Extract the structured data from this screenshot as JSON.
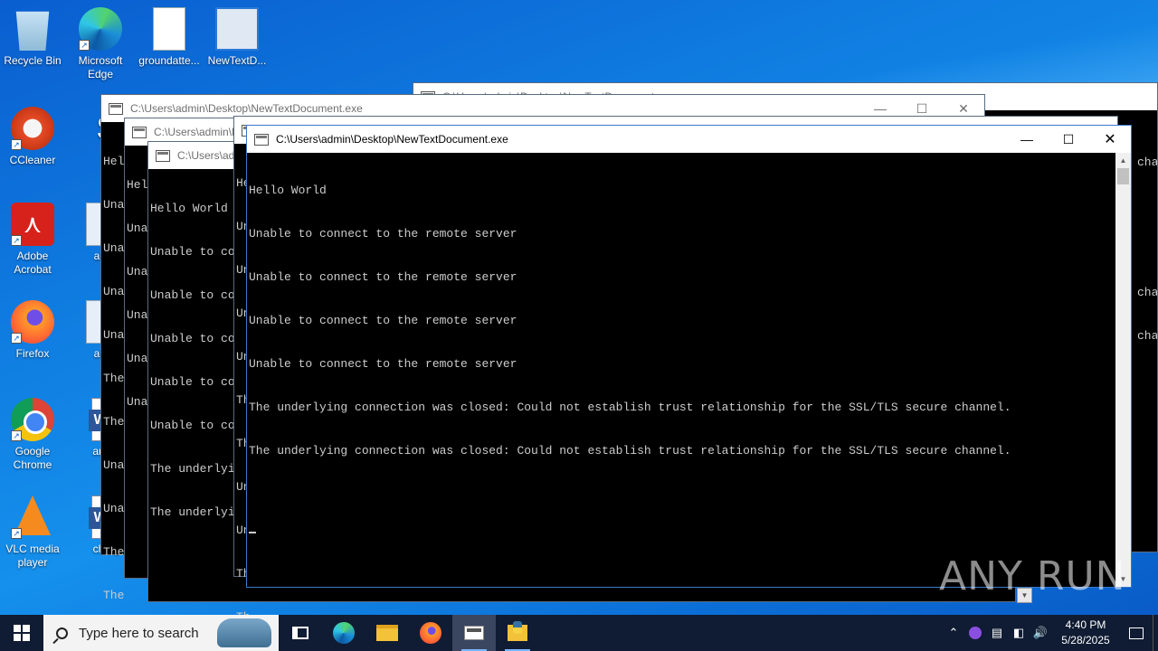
{
  "desktop": {
    "icons": [
      {
        "label": "Recycle Bin",
        "icon": "recycle-bin-icon"
      },
      {
        "label": "Microsoft Edge",
        "icon": "edge-icon"
      },
      {
        "label": "groundatte...",
        "icon": "image-file-icon"
      },
      {
        "label": "NewTextD...",
        "icon": "exe-file-icon"
      },
      {
        "label": "CCleaner",
        "icon": "ccleaner-icon"
      },
      {
        "label": "Sky",
        "icon": "skype-icon"
      },
      {
        "label": "Adobe Acrobat",
        "icon": "acrobat-icon"
      },
      {
        "label": "advice",
        "icon": "image-file-icon"
      },
      {
        "label": "Firefox",
        "icon": "firefox-icon"
      },
      {
        "label": "answe",
        "icon": "image-file-icon"
      },
      {
        "label": "Google Chrome",
        "icon": "chrome-icon"
      },
      {
        "label": "around",
        "icon": "word-doc-icon"
      },
      {
        "label": "VLC media player",
        "icon": "vlc-icon"
      },
      {
        "label": "charge",
        "icon": "word-doc-icon"
      }
    ]
  },
  "windows": {
    "title": "C:\\Users\\admin\\Desktop\\NewTextDocument.exe",
    "title_short_1": "C:\\Users\\admin\\D",
    "title_short_2": "C:\\Users\\adm",
    "back_lines": [
      "Hel",
      "Una",
      "Una",
      "Una",
      "Una",
      "The",
      "The",
      "Una",
      "Una",
      "The",
      "The"
    ],
    "mid_lines": [
      "Hel",
      "Una",
      "Una",
      "Una",
      "Una",
      "Una",
      "The"
    ],
    "left_lines": [
      "Hello World",
      "Unable to co",
      "Unable to co",
      "Unable to co",
      "Unable to co",
      "Unable to co",
      "The underlyi",
      "The underlyi"
    ],
    "strip_lines": [
      "He",
      "Un",
      "Un",
      "Un",
      "Un",
      "Th",
      "Th",
      "Un",
      "Un",
      "Th",
      "Th"
    ],
    "right_edge_lines": [
      "cha",
      "cha",
      "cha"
    ],
    "front_lines": [
      "Hello World",
      "Unable to connect to the remote server",
      "Unable to connect to the remote server",
      "Unable to connect to the remote server",
      "Unable to connect to the remote server",
      "The underlying connection was closed: Could not establish trust relationship for the SSL/TLS secure channel.",
      "The underlying connection was closed: Could not establish trust relationship for the SSL/TLS secure channel."
    ]
  },
  "watermark": "ANY RUN",
  "taskbar": {
    "search_placeholder": "Type here to search",
    "time": "4:40 PM",
    "date": "5/28/2025"
  }
}
